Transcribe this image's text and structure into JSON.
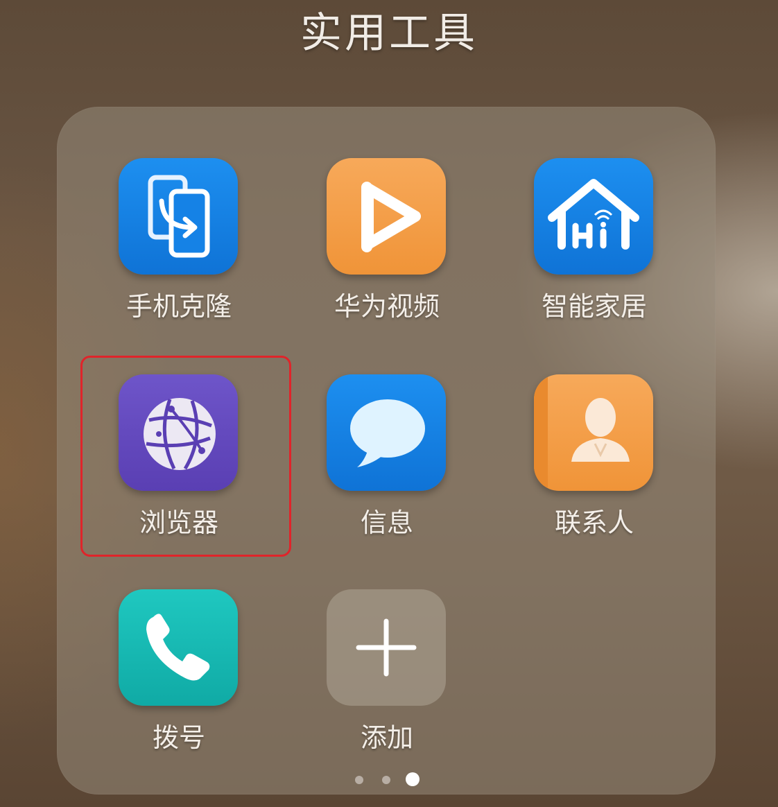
{
  "folder": {
    "title": "实用工具"
  },
  "apps": [
    {
      "label": "手机克隆",
      "icon": "phone-clone-icon",
      "color": "#1582e6"
    },
    {
      "label": "华为视频",
      "icon": "video-play-icon",
      "color": "#f4a04a"
    },
    {
      "label": "智能家居",
      "icon": "smart-home-icon",
      "color": "#1582e6"
    },
    {
      "label": "浏览器",
      "icon": "globe-icon",
      "color": "#644ac0"
    },
    {
      "label": "信息",
      "icon": "message-bubble-icon",
      "color": "#1582e6"
    },
    {
      "label": "联系人",
      "icon": "contact-person-icon",
      "color": "#f4a04a"
    },
    {
      "label": "拨号",
      "icon": "phone-handset-icon",
      "color": "#16bab4"
    },
    {
      "label": "添加",
      "icon": "plus-icon",
      "color": "#b0a597"
    }
  ],
  "highlight": {
    "target": "浏览器",
    "color": "#e0242a"
  },
  "pagination": {
    "total_pages": 3,
    "current_page": 3
  }
}
